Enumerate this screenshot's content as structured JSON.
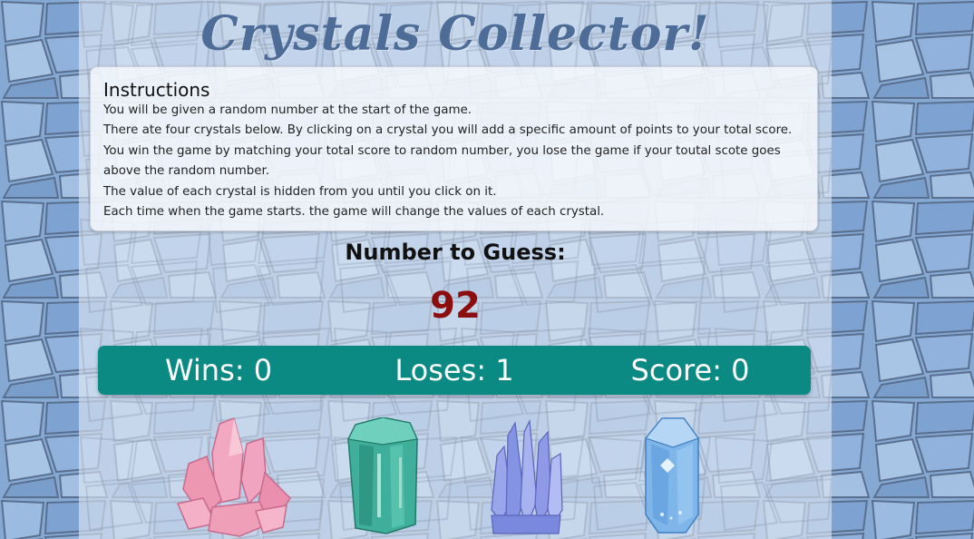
{
  "title": "Crystals Collector!",
  "instructions": {
    "heading": "Instructions",
    "lines": [
      "You will be given a random number at the start of the game.",
      "There ate four crystals below. By clicking on a crystal you will add a specific amount of points to your total score.",
      "You win the game by matching your total score to random number, you lose the game if your toutal scote goes above the random number.",
      "The value of each crystal is hidden from you until you click on it.",
      "Each time when the game starts. the game will change the values of each crystal."
    ]
  },
  "guess": {
    "label": "Number to Guess:",
    "value": "92"
  },
  "stats": {
    "wins": "Wins: 0",
    "loses": "Loses: 1",
    "score": "Score: 0"
  },
  "crystals": [
    {
      "name": "pink-crystal-cluster",
      "color": "#ef9fb8"
    },
    {
      "name": "green-crystal",
      "color": "#3fae9a"
    },
    {
      "name": "purple-crystal-cluster",
      "color": "#8f9be6"
    },
    {
      "name": "blue-crystal",
      "color": "#7fb6ea"
    }
  ],
  "colors": {
    "title": "#4d6c98",
    "number": "#8b0d0d",
    "scorebar": "#0a8a82"
  }
}
